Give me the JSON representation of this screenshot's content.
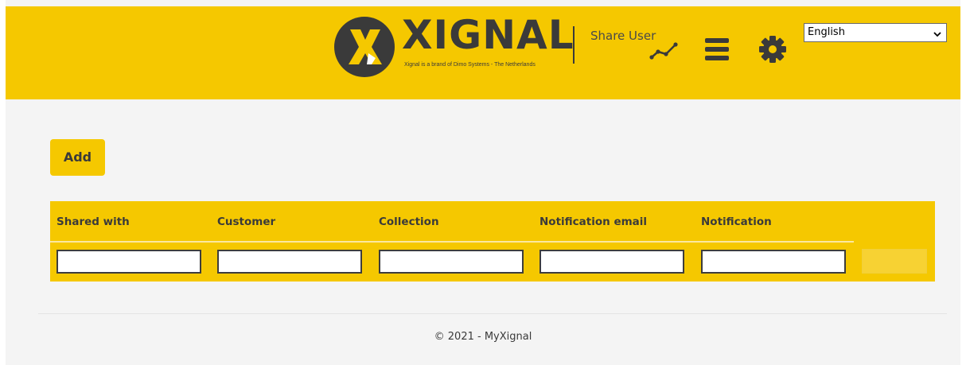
{
  "header": {
    "brand": "XIGNAL",
    "tagline": "Xignal is a brand of Dimo Systems - The Netherlands",
    "page_title": "Share User",
    "language": {
      "selected": "English"
    },
    "icons": {
      "logo": "x-logo-icon",
      "trend": "trend-line-icon",
      "menu": "hamburger-menu-icon",
      "settings": "gear-icon"
    },
    "colors": {
      "brand_yellow": "#f5c800",
      "dark": "#3a3a3a"
    }
  },
  "main": {
    "add_label": "Add",
    "table": {
      "columns": [
        "Shared with",
        "Customer",
        "Collection",
        "Notification email",
        "Notification"
      ],
      "filters": [
        "",
        "",
        "",
        "",
        ""
      ]
    }
  },
  "footer": {
    "text": "© 2021 - MyXignal"
  }
}
